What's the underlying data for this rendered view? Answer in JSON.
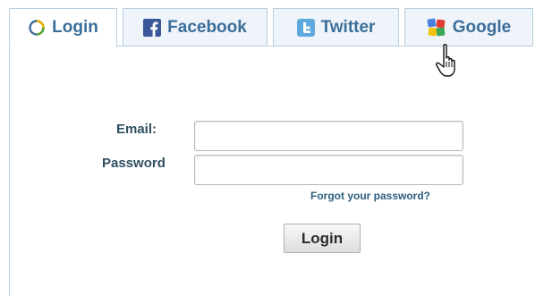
{
  "tabs": [
    {
      "label": "Login",
      "icon": "login-circle-icon"
    },
    {
      "label": "Facebook",
      "icon": "facebook-icon"
    },
    {
      "label": "Twitter",
      "icon": "twitter-icon"
    },
    {
      "label": "Google",
      "icon": "google-icon"
    }
  ],
  "form": {
    "email_label": "Email:",
    "email_value": "",
    "password_label": "Password",
    "password_value": "",
    "forgot_link": "Forgot your password?",
    "login_button": "Login"
  },
  "colors": {
    "tab_text": "#3b6e9a",
    "border": "#b9cfe0",
    "facebook_blue": "#3b5998",
    "twitter_blue": "#5ea9dd"
  }
}
